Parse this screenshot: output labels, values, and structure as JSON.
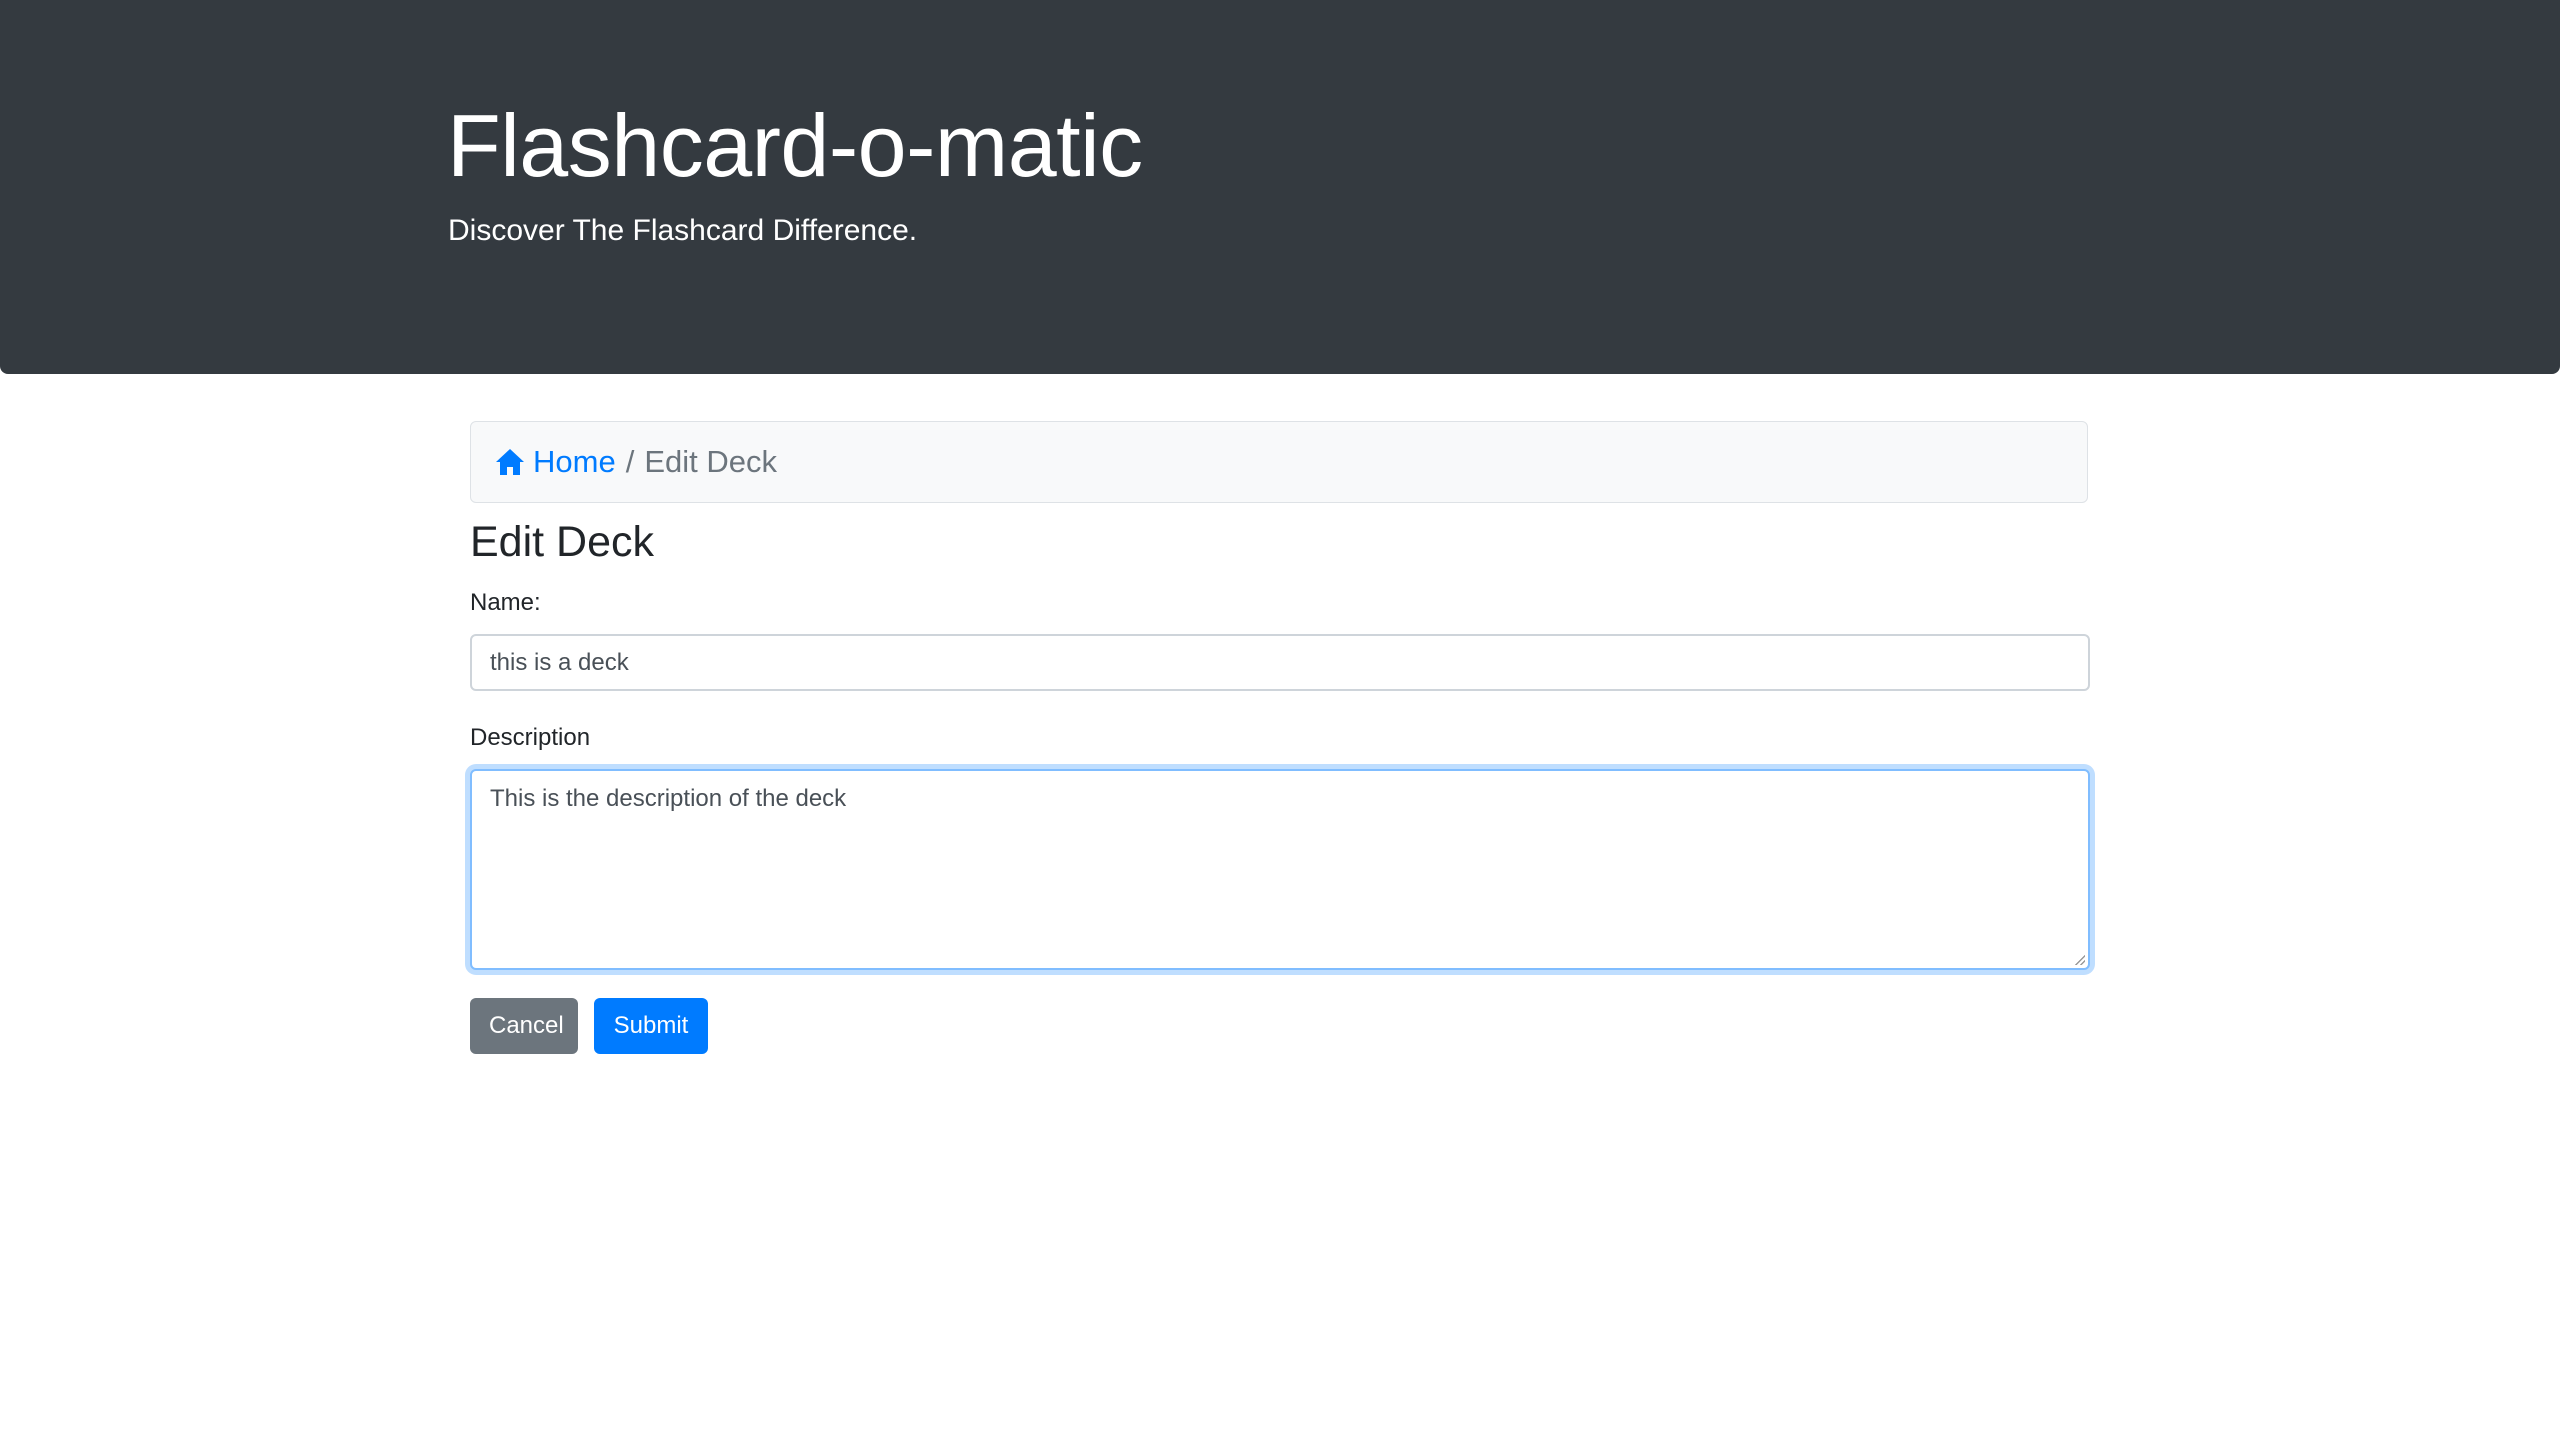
{
  "header": {
    "title": "Flashcard-o-matic",
    "tagline": "Discover The Flashcard Difference."
  },
  "breadcrumb": {
    "home_label": "Home",
    "separator": "/",
    "current": "Edit Deck",
    "home_icon": "home-icon",
    "link_color": "#007bff"
  },
  "page": {
    "title": "Edit Deck"
  },
  "form": {
    "name_label": "Name:",
    "name_value": "this is a deck",
    "description_label": "Description",
    "description_value": "This is the description of the deck",
    "cancel_label": "Cancel",
    "submit_label": "Submit"
  }
}
